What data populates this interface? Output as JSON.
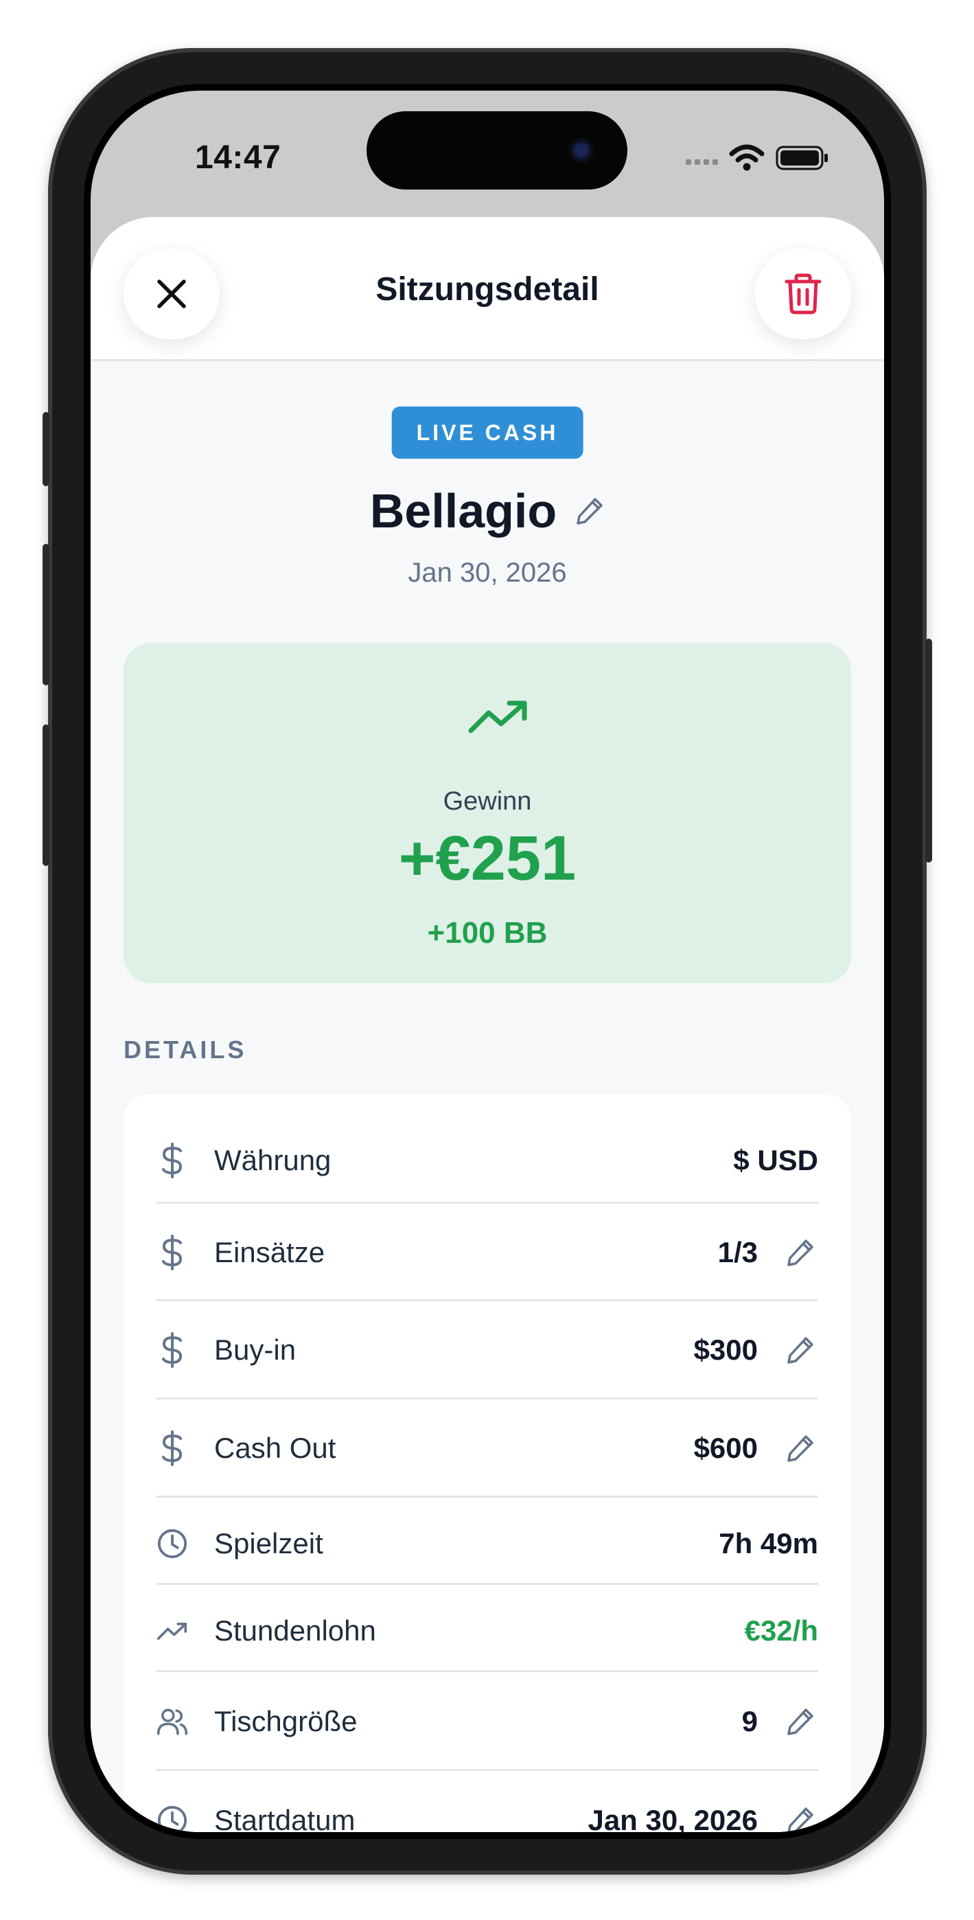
{
  "status_bar": {
    "time": "14:47"
  },
  "nav": {
    "title": "Sitzungsdetail",
    "close_icon": "close-icon",
    "delete_icon": "trash-icon"
  },
  "session": {
    "type_badge": "LIVE CASH",
    "venue": "Bellagio",
    "date": "Jan 30, 2026"
  },
  "result": {
    "label": "Gewinn",
    "amount": "+€251",
    "big_blinds": "+100 BB",
    "color": "#21a04e"
  },
  "details": {
    "title": "DETAILS",
    "rows": [
      {
        "icon": "dollar-icon",
        "label": "Währung",
        "value": "$ USD",
        "editable": false
      },
      {
        "icon": "dollar-icon",
        "label": "Einsätze",
        "value": "1/3",
        "editable": true
      },
      {
        "icon": "dollar-icon",
        "label": "Buy-in",
        "value": "$300",
        "editable": true
      },
      {
        "icon": "dollar-icon",
        "label": "Cash Out",
        "value": "$600",
        "editable": true
      },
      {
        "icon": "clock-icon",
        "label": "Spielzeit",
        "value": "7h 49m",
        "editable": false
      },
      {
        "icon": "trend-up-icon",
        "label": "Stundenlohn",
        "value": "€32/h",
        "editable": false
      },
      {
        "icon": "users-icon",
        "label": "Tischgröße",
        "value": "9",
        "editable": true
      },
      {
        "icon": "clock-icon",
        "label": "Startdatum",
        "value": "Jan 30, 2026",
        "editable": true
      }
    ]
  },
  "colors": {
    "accent_blue": "#2f8fd6",
    "delete_red": "#e0244a",
    "profit_bg": "#dff0e7"
  }
}
